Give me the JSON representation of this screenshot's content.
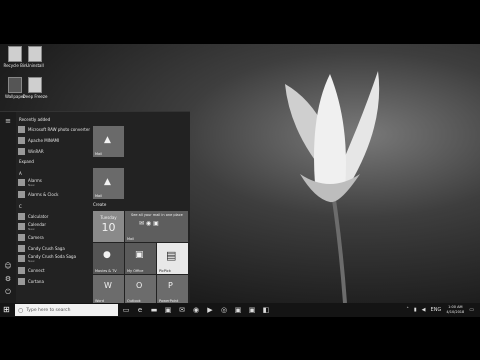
{
  "desktop": {
    "icons": [
      {
        "label": "Recycle Bin",
        "icon": "recycle-bin-icon"
      },
      {
        "label": "Uninstall",
        "icon": "file-icon"
      },
      {
        "label": "Wallpaper",
        "icon": "image-icon"
      },
      {
        "label": "Deep Freeze",
        "icon": "file-icon"
      }
    ]
  },
  "start_menu": {
    "recently_added_label": "Recently added",
    "recent": [
      {
        "label": "Microsoft RAW photo converter"
      },
      {
        "label": "Apache MINAMI"
      },
      {
        "label": "WinRAR"
      }
    ],
    "expand_label": "Expand",
    "letters": [
      "A",
      "C"
    ],
    "apps_a": [
      {
        "label": "Alarms",
        "sub": "New"
      },
      {
        "label": "Alarms & Clock",
        "sub": ""
      }
    ],
    "apps_c": [
      {
        "label": "Calculator",
        "sub": ""
      },
      {
        "label": "Calendar",
        "sub": "New"
      },
      {
        "label": "Camera",
        "sub": ""
      },
      {
        "label": "Candy Crush Saga",
        "sub": ""
      },
      {
        "label": "Candy Crush Soda Saga",
        "sub": "New"
      },
      {
        "label": "Connect",
        "sub": ""
      },
      {
        "label": "Cortana",
        "sub": ""
      }
    ],
    "tiles": {
      "top_tiles": [
        {
          "label": "Mail"
        },
        {
          "label": "Mail"
        }
      ],
      "group_label": "Create",
      "calendar_day": "Tuesday",
      "calendar_date": "10",
      "mail_tile_text": "See all your mail in one place",
      "mail_label": "Mail",
      "row2": [
        {
          "label": "Movies & TV"
        },
        {
          "label": "My Office"
        },
        {
          "label": "PicPick"
        }
      ],
      "row3": [
        {
          "label": "Word"
        },
        {
          "label": "Outlook"
        },
        {
          "label": "PowerPoint"
        }
      ]
    }
  },
  "taskbar": {
    "search_placeholder": "Type here to search",
    "time": "1:00 AM",
    "date": "4/10/2018",
    "lang": "ENG"
  }
}
